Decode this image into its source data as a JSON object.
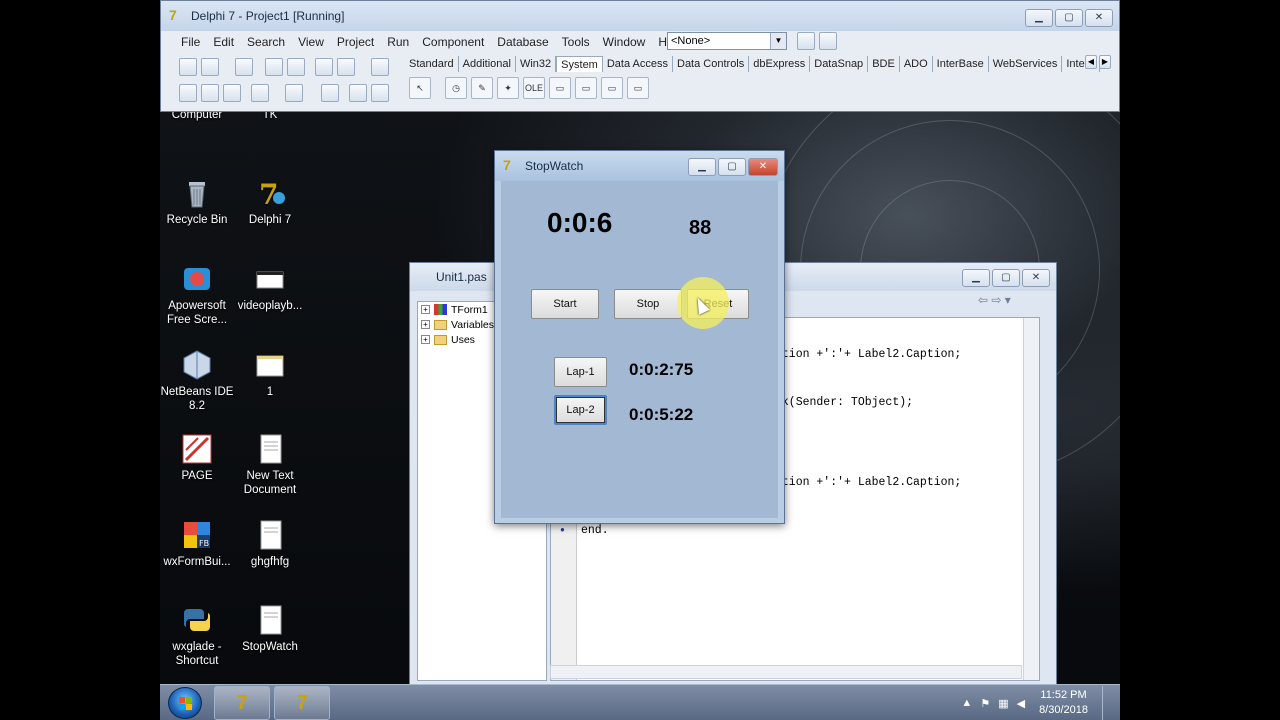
{
  "ide": {
    "title": "Delphi 7 - Project1 [Running]",
    "menu": [
      "File",
      "Edit",
      "Search",
      "View",
      "Project",
      "Run",
      "Component",
      "Database",
      "Tools",
      "Window",
      "Help"
    ],
    "combo_value": "<None>",
    "palette_tabs": [
      "Standard",
      "Additional",
      "Win32",
      "System",
      "Data Access",
      "Data Controls",
      "dbExpress",
      "DataSnap",
      "BDE",
      "ADO",
      "InterBase",
      "WebServices",
      "Intern"
    ],
    "active_tab": "System",
    "palette_ole": "OLE"
  },
  "desktop": {
    "icons": [
      {
        "label": "Computer"
      },
      {
        "label": "TK"
      },
      {
        "label": "Recycle Bin"
      },
      {
        "label": "Delphi 7"
      },
      {
        "label": "Apowersoft Free Scre..."
      },
      {
        "label": "videoplayb..."
      },
      {
        "label": "NetBeans IDE 8.2"
      },
      {
        "label": "1"
      },
      {
        "label": "PAGE"
      },
      {
        "label": "New Text Document"
      },
      {
        "label": "wxFormBui..."
      },
      {
        "label": "ghgfhfg"
      },
      {
        "label": "wxglade - Shortcut"
      },
      {
        "label": "StopWatch"
      }
    ]
  },
  "editor": {
    "title": "Unit1.pas",
    "tree": [
      "TForm1",
      "Variables",
      "Uses"
    ],
    "code_lines": [
      "ption +':'+ Label2.Caption;",
      "ck(Sender: TObject);",
      "ption +':'+ Label2.Caption;",
      "end."
    ]
  },
  "stopwatch": {
    "title": "StopWatch",
    "time": "0:0:6",
    "centis": "88",
    "start_label": "Start",
    "stop_label": "Stop",
    "reset_label": "Reset",
    "lap1_label": "Lap-1",
    "lap1_value": "0:0:2:75",
    "lap2_label": "Lap-2",
    "lap2_value": "0:0:5:22"
  },
  "taskbar": {
    "time": "11:52 PM",
    "date": "8/30/2018",
    "task_glyph": "7"
  }
}
